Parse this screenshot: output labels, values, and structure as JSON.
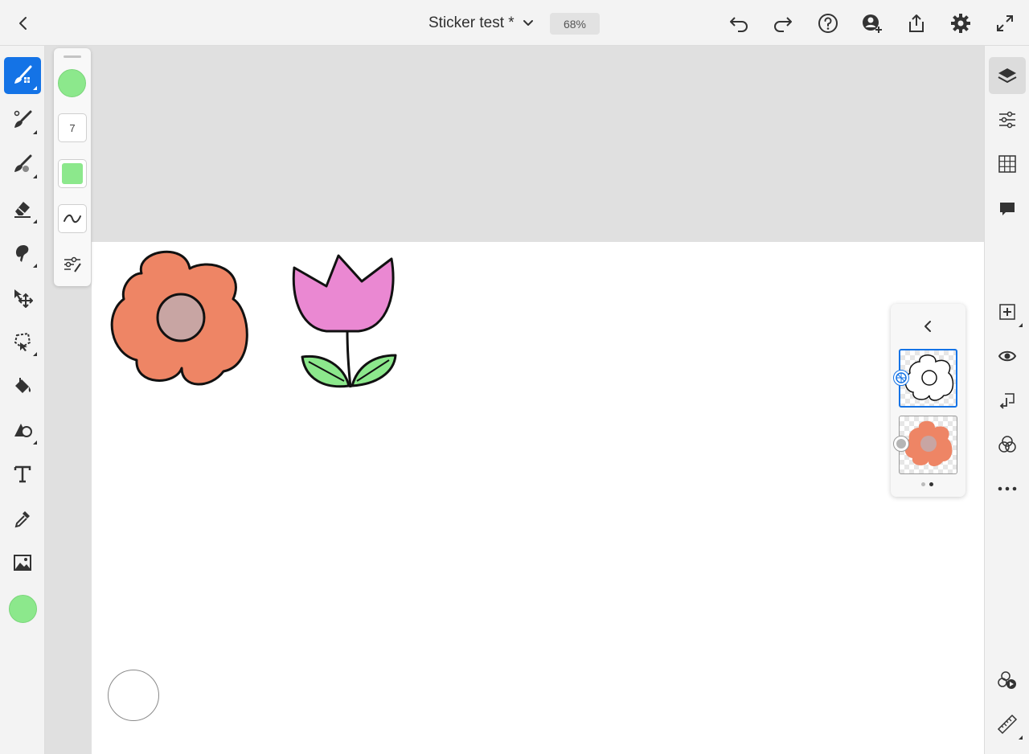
{
  "header": {
    "document_title": "Sticker test *",
    "zoom_level": "68%"
  },
  "left_toolbar": {
    "tools": [
      {
        "name": "pixel-brush",
        "active": true
      },
      {
        "name": "paint-brush",
        "active": false
      },
      {
        "name": "blend-brush",
        "active": false
      },
      {
        "name": "eraser",
        "active": false
      },
      {
        "name": "smudge",
        "active": false
      },
      {
        "name": "move-transform",
        "active": false
      },
      {
        "name": "lasso-select",
        "active": false
      },
      {
        "name": "fill",
        "active": false
      },
      {
        "name": "shapes",
        "active": false
      },
      {
        "name": "text",
        "active": false
      },
      {
        "name": "eyedropper",
        "active": false
      },
      {
        "name": "image",
        "active": false
      }
    ],
    "current_color": "#8ce88c"
  },
  "brush_panel": {
    "brush_size": "7",
    "color": "#8ce88c"
  },
  "right_toolbar": {
    "items": [
      "layers-icon",
      "adjustments-icon",
      "grid-icon",
      "comment-icon",
      "add-layer-icon",
      "visibility-icon",
      "merge-down-icon",
      "blend-modes-icon",
      "more-icon",
      "symmetry-icon",
      "ruler-icon"
    ]
  },
  "layers_panel": {
    "layers": [
      {
        "name": "outline-layer",
        "selected": true
      },
      {
        "name": "color-layer",
        "selected": false
      }
    ],
    "pages": 2,
    "current_page": 2
  },
  "colors": {
    "accent": "#1473e6",
    "flower_orange": "#ee8565",
    "flower_center": "#c8a5a3",
    "tulip_pink": "#ea88d2",
    "leaf_green": "#8ce88c"
  }
}
